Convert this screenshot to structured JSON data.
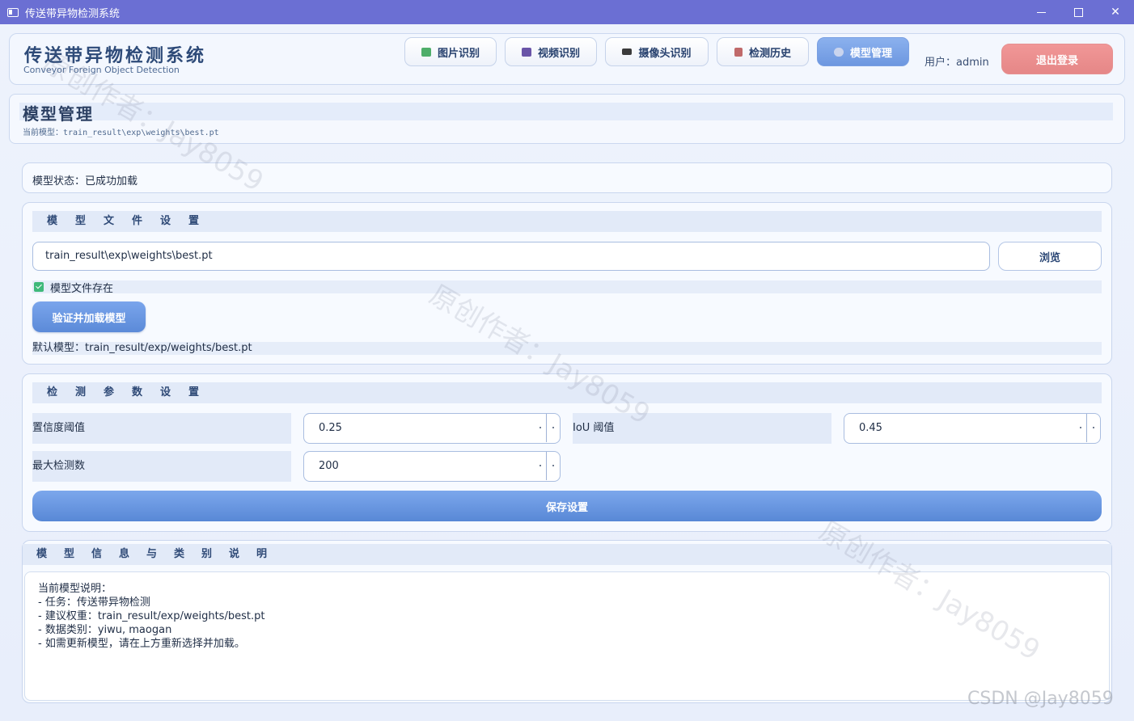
{
  "window": {
    "title": "传送带异物检测系统"
  },
  "header": {
    "title": "传送带异物检测系统",
    "subtitle": "Conveyor Foreign Object Detection",
    "nav": [
      {
        "label": "图片识别",
        "icon": "image-icon",
        "color": "#4fae6a"
      },
      {
        "label": "视频识别",
        "icon": "clapper-icon",
        "color": "#6a55a8"
      },
      {
        "label": "摄像头识别",
        "icon": "camera-icon",
        "color": "#3b3b3b"
      },
      {
        "label": "检测历史",
        "icon": "list-icon",
        "color": "#c06a6a"
      },
      {
        "label": "模型管理",
        "icon": "gear-icon",
        "color": "#c9d4ee"
      }
    ],
    "user_label": "用户：admin",
    "logout_label": "退出登录"
  },
  "page": {
    "title": "模型管理",
    "current_model": "当前模型：train_result\\exp\\weights\\best.pt"
  },
  "status": {
    "text": "模型状态：已成功加载"
  },
  "model_file": {
    "section_title": "模型文件设置",
    "path_value": "train_result\\exp\\weights\\best.pt",
    "browse_label": "浏览",
    "exists_label": "模型文件存在",
    "load_label": "验证并加载模型",
    "default_model": "默认模型：train_result/exp/weights/best.pt"
  },
  "params": {
    "section_title": "检测参数设置",
    "conf_label": "置信度阈值",
    "conf_value": "0.25",
    "iou_label": "IoU 阈值",
    "iou_value": "0.45",
    "max_label": "最大检测数",
    "max_value": "200",
    "save_label": "保存设置"
  },
  "info": {
    "section_title": "模型信息与类别说明",
    "lines": [
      "当前模型说明：",
      "- 任务：传送带异物检测",
      "- 建议权重：train_result/exp/weights/best.pt",
      "- 数据类别：yiwu, maogan",
      "- 如需更新模型，请在上方重新选择并加载。"
    ]
  },
  "watermark": "原创作者：Jay8059",
  "csdn_mark": "CSDN @Jay8059",
  "colors": {
    "accent": "#6d97e0",
    "titlebar": "#6b6fd3",
    "logout": "#e58787"
  }
}
